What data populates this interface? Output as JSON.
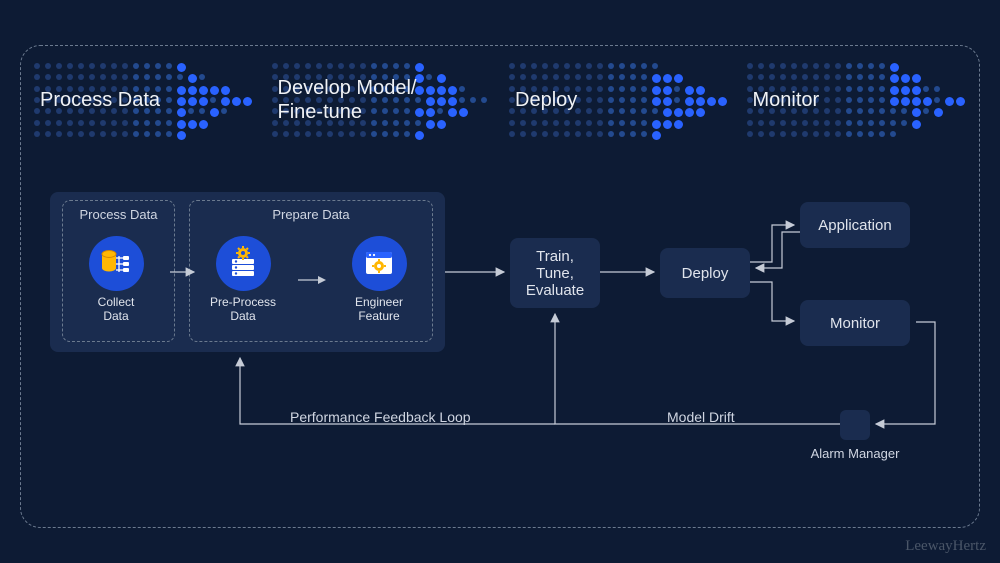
{
  "stages": {
    "s1": "Process Data",
    "s2": "Develop Model/\nFine-tune",
    "s3": "Deploy",
    "s4": "Monitor"
  },
  "process_data": {
    "group_collect_title": "Process Data",
    "group_prepare_title": "Prepare Data",
    "collect_label": "Collect\nData",
    "preprocess_label": "Pre-Process\nData",
    "engineer_label": "Engineer\nFeature"
  },
  "flow": {
    "train_label": "Train,\nTune,\nEvaluate",
    "deploy_label": "Deploy",
    "application_label": "Application",
    "monitor_label": "Monitor",
    "alarm_label": "Alarm Manager",
    "perf_loop_label": "Performance Feedback Loop",
    "model_drift_label": "Model Drift"
  },
  "watermark": "LeewayHertz"
}
